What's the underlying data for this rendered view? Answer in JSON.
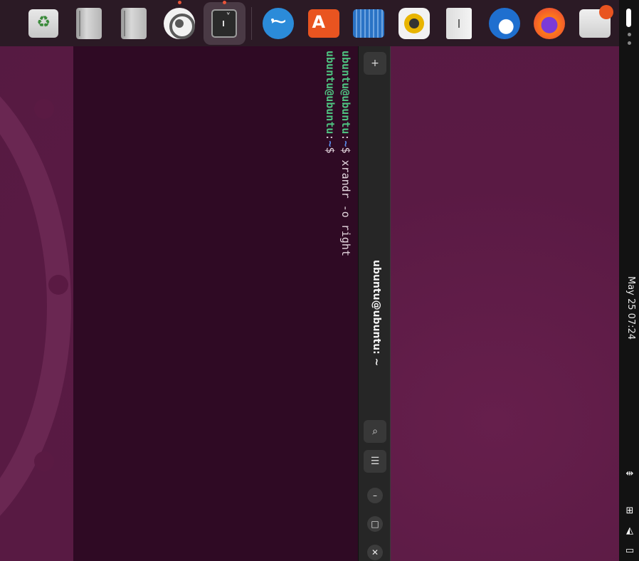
{
  "dock": {
    "apps": [
      {
        "name": "Trash",
        "icon": "trash-icon",
        "running": false,
        "active": false
      },
      {
        "name": "Drive 1",
        "icon": "drive-icon",
        "running": false,
        "active": false
      },
      {
        "name": "Drive 2",
        "icon": "drive-icon",
        "running": false,
        "active": false
      },
      {
        "name": "Settings",
        "icon": "settings-icon",
        "running": true,
        "active": false
      },
      {
        "name": "Terminal",
        "icon": "terminal-icon",
        "running": true,
        "active": true
      },
      {
        "name": "Tux app",
        "icon": "tux-icon",
        "running": false,
        "active": false
      },
      {
        "name": "Orange app",
        "icon": "orange-app-icon",
        "running": false,
        "active": false
      },
      {
        "name": "Blue app",
        "icon": "blue-app-icon",
        "running": false,
        "active": false
      },
      {
        "name": "Rhythmbox",
        "icon": "rhythmbox-icon",
        "running": false,
        "active": false
      },
      {
        "name": "Writer",
        "icon": "writer-icon",
        "running": false,
        "active": false
      },
      {
        "name": "Thunderbird",
        "icon": "thunderbird-icon",
        "running": false,
        "active": false
      },
      {
        "name": "Firefox",
        "icon": "firefox-icon",
        "running": false,
        "active": false
      },
      {
        "name": "Disks",
        "icon": "disks-icon",
        "running": false,
        "active": false
      }
    ],
    "running_indicator_color": "#e9543a"
  },
  "top_panel": {
    "clock": "May 25  07:24",
    "status_icons": [
      "accessibility-icon",
      "network-icon",
      "volume-icon",
      "battery-icon"
    ]
  },
  "terminal": {
    "title": "ubuntu@ubuntu: ~",
    "lines": [
      {
        "prompt": "ubuntu@ubuntu",
        "sep": ":",
        "path": "~",
        "symbol": "$",
        "command": " xrandr -o right"
      },
      {
        "prompt": "ubuntu@ubuntu",
        "sep": ":",
        "path": "~",
        "symbol": "$",
        "command": ""
      }
    ],
    "buttons": {
      "new_tab": "+",
      "search": "⌕",
      "menu": "☰",
      "minimize": "–",
      "maximize": "□",
      "close": "✕"
    }
  },
  "colors": {
    "wallpaper": "#5a1b44",
    "terminal_bg": "#2f0a24",
    "prompt": "#4ec07f",
    "path": "#5b8ff0"
  }
}
